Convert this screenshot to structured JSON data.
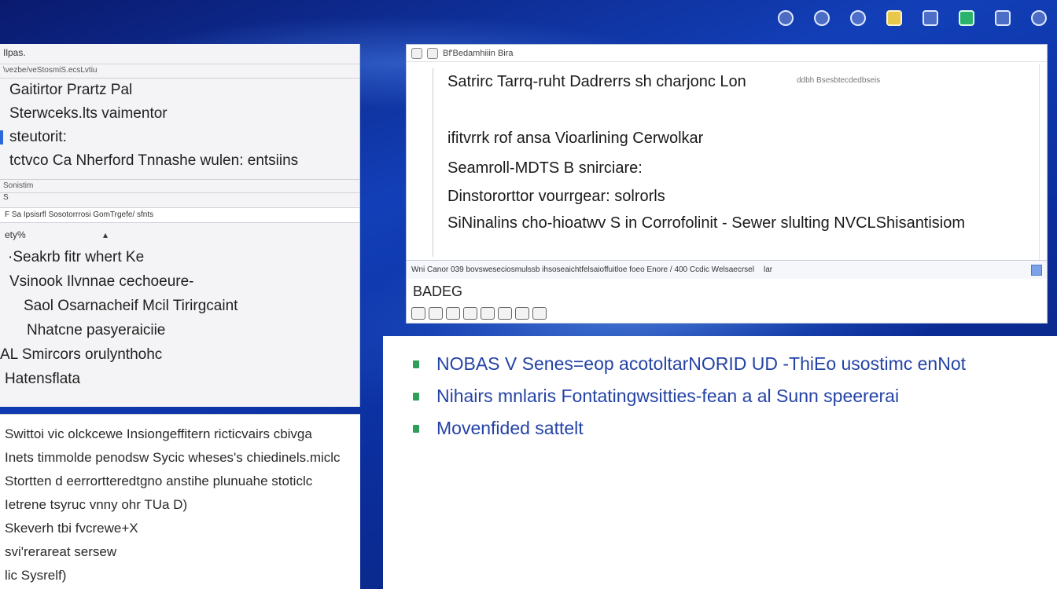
{
  "colors": {
    "desktop": "#123fb8",
    "accent_bullets": "#2f9e59",
    "bullet_text": "#2443a6",
    "selection_bar": "#2b6ad8"
  },
  "tray": {
    "icons": [
      "app-icon",
      "shield-icon",
      "globe-icon",
      "chart-icon",
      "window-icon",
      "network-icon",
      "folder-icon",
      "settings-icon"
    ]
  },
  "left_panel": {
    "title": "Ilpas.",
    "subtitle": "\\vezbe/veStosmiS.ecsLvtiu",
    "menu": [
      {
        "label": "Gaitirtor   Prartz Pal"
      },
      {
        "label": "Sterwceks.lts   vaimentor"
      },
      {
        "label": "steutorit:"
      },
      {
        "label": "tctvco Ca Nherford Tnnashe wulen:      entsiins"
      }
    ],
    "section_label": "Sonistim",
    "small_label": "S",
    "filter_text": "F Sa Ipsisrfl Sosotorrrosi GomTrgefe/ sfnts",
    "filter_value": "ety%",
    "list_items": [
      "·Seakrb fitr whert Ke",
      "Vsinook Ilvnnae cechoeure-",
      "Saol Osarnacheif Mcil Tirirgcaint",
      "Nhatcne pasyeraiciie",
      "AL Smircors orulynthohc",
      "Hatensflata"
    ]
  },
  "left_bottom": {
    "lines": [
      "Swittoi vic olckcewe Insiongeffitern ricticvairs cbivga",
      "Inets timmolde penodsw Sycic wheses's chiedinels.miclc",
      "Stortten d eerrortteredtgno anstihe plunuahe stoticlc",
      "Ietrene tsyruc vnny ohr TUa D)",
      "Skeverh tbi fvcrewe+X",
      "svi'rerareat sersew",
      "lic Sysrelf)"
    ]
  },
  "editor": {
    "title": "Bf'Bedamhiiin Bira",
    "meta": "ddbh   Bsesbtecdedbseis",
    "lines": [
      "Satrirc Tarrq-ruht Dadrerrs sh charjonc Lon",
      "ifitvrrk rof ansa Vioarlining Cerwolkar",
      "Seamroll-MDTS B  snirciare:",
      "Dinstororttor vourrgear: solrorls",
      "SiNinalins cho-hioatwv S in Corrofolinit -  Sewer slulting NVCLShisantisiom"
    ],
    "status": "Wni Canor 039  bovsweseciosmulssb  ihsoseaichtfelsaioffuitloe foeo Enore  /      400  Ccdic      Welsaecrsel",
    "status_right": "lar",
    "badge": "BADEG"
  },
  "right_panel": {
    "items": [
      "NOBAS V Senes=eop acotoltarNORID UD -ThiEo usostimc enNot",
      "Nihairs mnlaris Fontatingwsitties-fean a al Sunn speererai",
      "Movenfided sattelt"
    ]
  }
}
